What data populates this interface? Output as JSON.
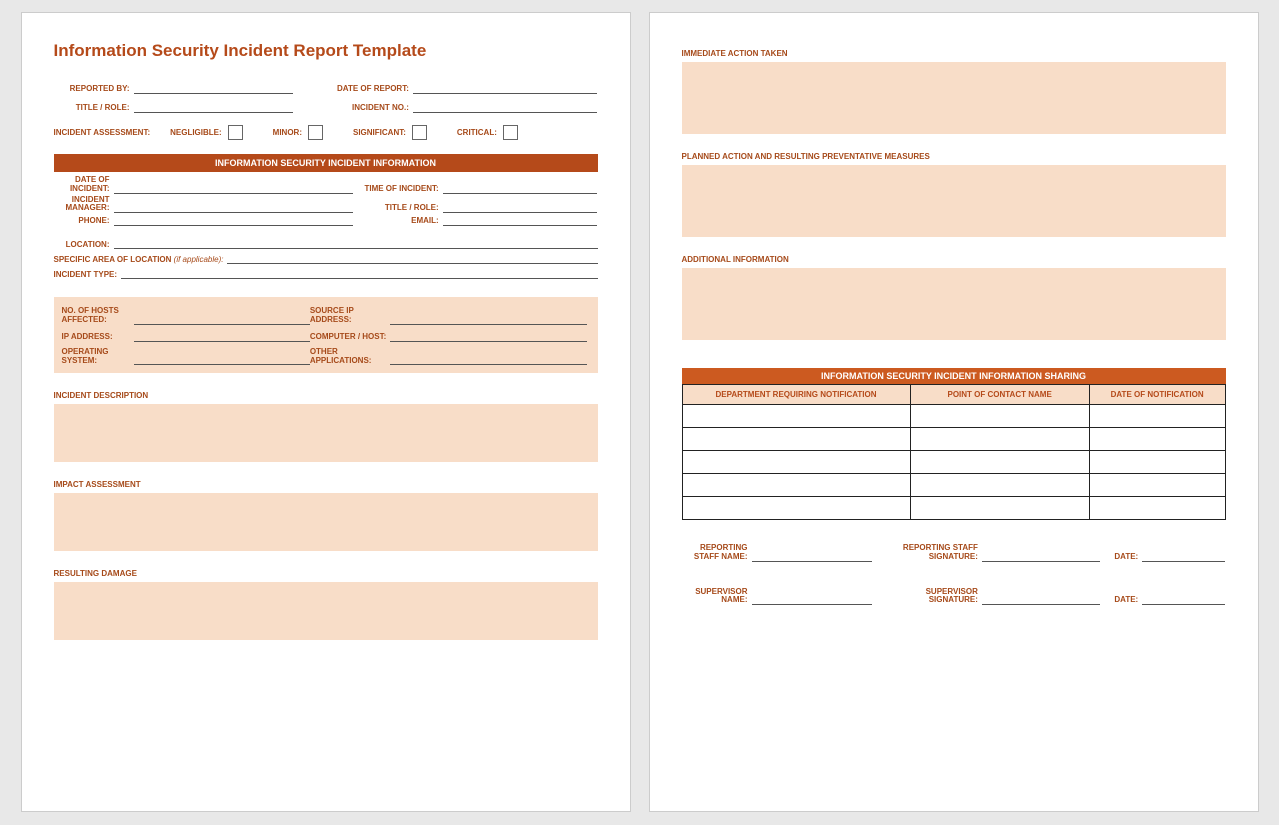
{
  "page1": {
    "title": "Information Security Incident Report Template",
    "reported_by": "REPORTED BY:",
    "date_of_report": "DATE OF REPORT:",
    "title_role": "TITLE / ROLE:",
    "incident_no": "INCIDENT NO.:",
    "assessment": "INCIDENT ASSESSMENT:",
    "negligible": "NEGLIGIBLE:",
    "minor": "MINOR:",
    "significant": "SIGNIFICANT:",
    "critical": "CRITICAL:",
    "info_bar": "INFORMATION SECURITY INCIDENT INFORMATION",
    "date_of_incident": "DATE OF INCIDENT:",
    "time_of_incident": "TIME OF INCIDENT:",
    "incident_manager": "INCIDENT MANAGER:",
    "title_role2": "TITLE / ROLE:",
    "phone": "PHONE:",
    "email": "EMAIL:",
    "location": "LOCATION:",
    "specific_area": "SPECIFIC AREA OF LOCATION",
    "if_applicable": "(if applicable):",
    "incident_type": "INCIDENT TYPE:",
    "hosts": "NO. OF HOSTS AFFECTED:",
    "source_ip": "SOURCE IP ADDRESS:",
    "ip_addr": "IP ADDRESS:",
    "comp_host": "COMPUTER / HOST:",
    "os": "OPERATING SYSTEM:",
    "other_apps": "OTHER APPLICATIONS:",
    "incident_desc": "INCIDENT DESCRIPTION",
    "impact": "IMPACT ASSESSMENT",
    "damage": "RESULTING DAMAGE"
  },
  "page2": {
    "immediate": "IMMEDIATE ACTION TAKEN",
    "planned": "PLANNED ACTION AND RESULTING PREVENTATIVE MEASURES",
    "additional": "ADDITIONAL INFORMATION",
    "sharing_bar": "INFORMATION SECURITY INCIDENT INFORMATION SHARING",
    "col1": "DEPARTMENT REQUIRING NOTIFICATION",
    "col2": "POINT OF CONTACT NAME",
    "col3": "DATE OF NOTIFICATION",
    "rep_staff_name": "REPORTING STAFF NAME:",
    "rep_staff_sig": "REPORTING STAFF SIGNATURE:",
    "date": "DATE:",
    "sup_name": "SUPERVISOR NAME:",
    "sup_sig": "SUPERVISOR SIGNATURE:"
  }
}
